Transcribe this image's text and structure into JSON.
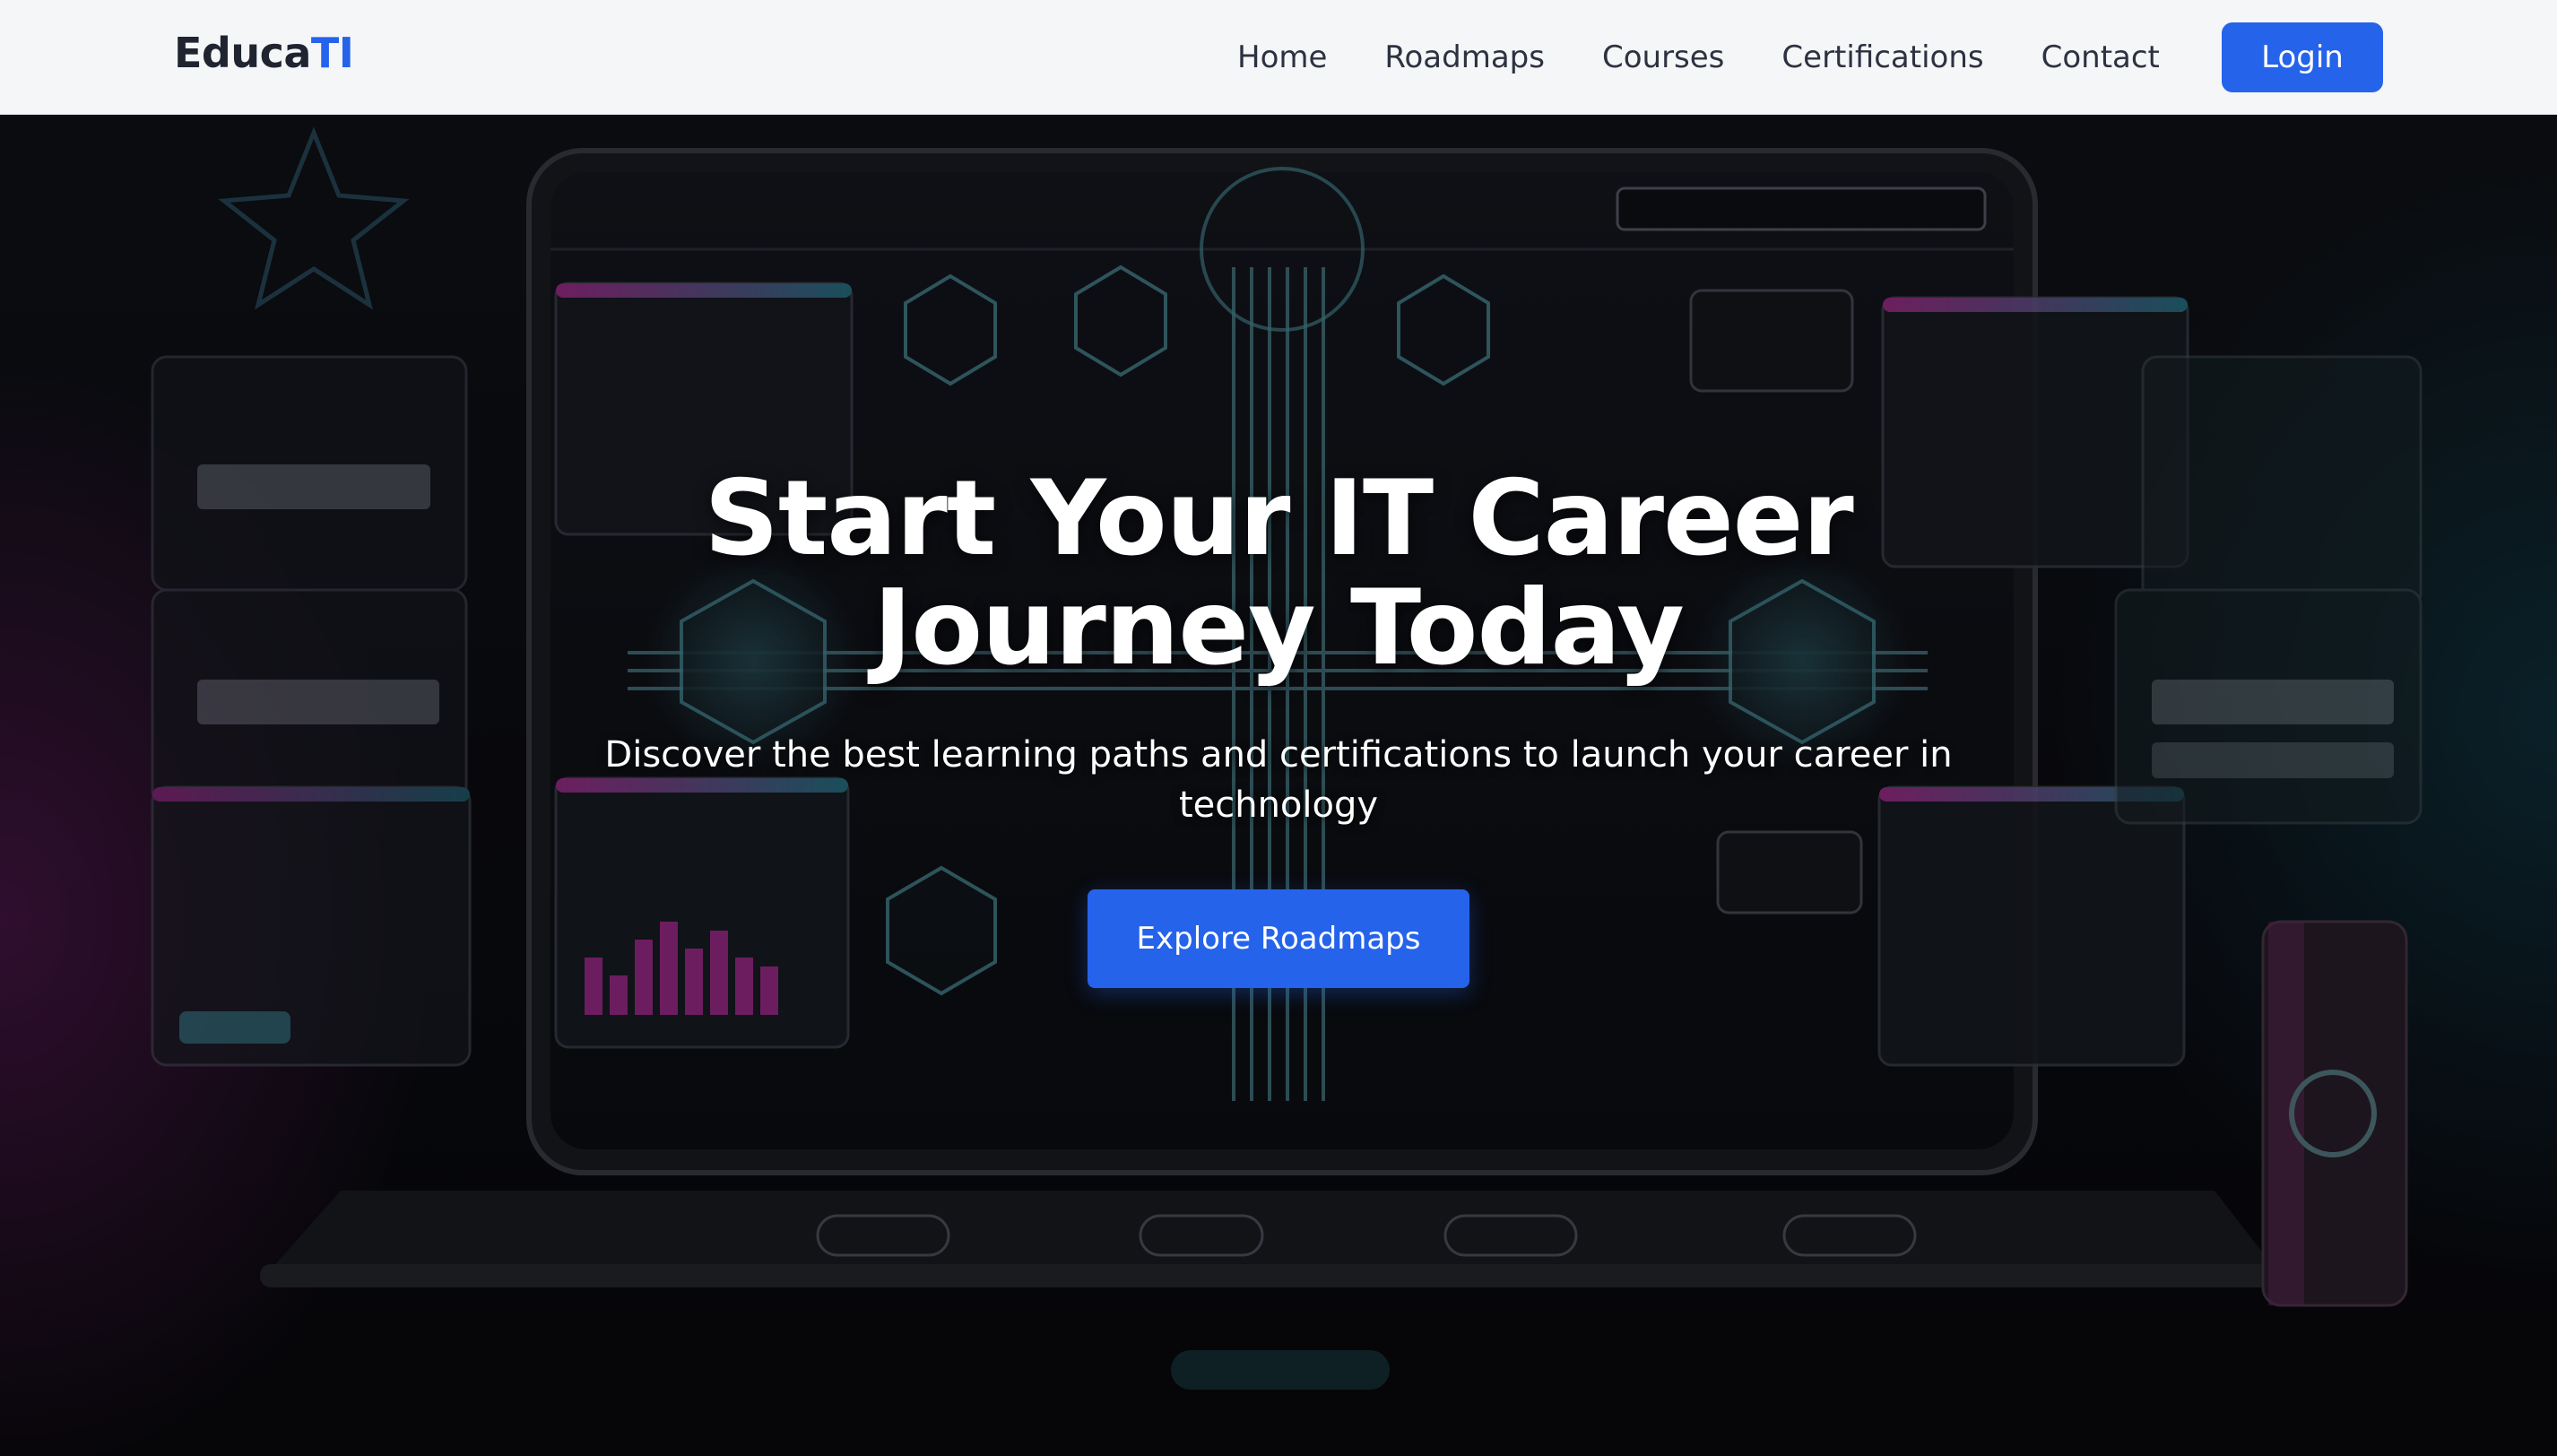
{
  "brand": {
    "name_main": "Educa",
    "name_accent": "TI",
    "accent_color": "#2563eb"
  },
  "nav": {
    "links": [
      "Home",
      "Roadmaps",
      "Courses",
      "Certifications",
      "Contact"
    ],
    "login_label": "Login"
  },
  "hero": {
    "title_line1": "Start Your IT Career",
    "title_line2": "Journey Today",
    "subtitle": "Discover the best learning paths and certifications to launch your career in technology",
    "cta_label": "Explore Roadmaps"
  }
}
